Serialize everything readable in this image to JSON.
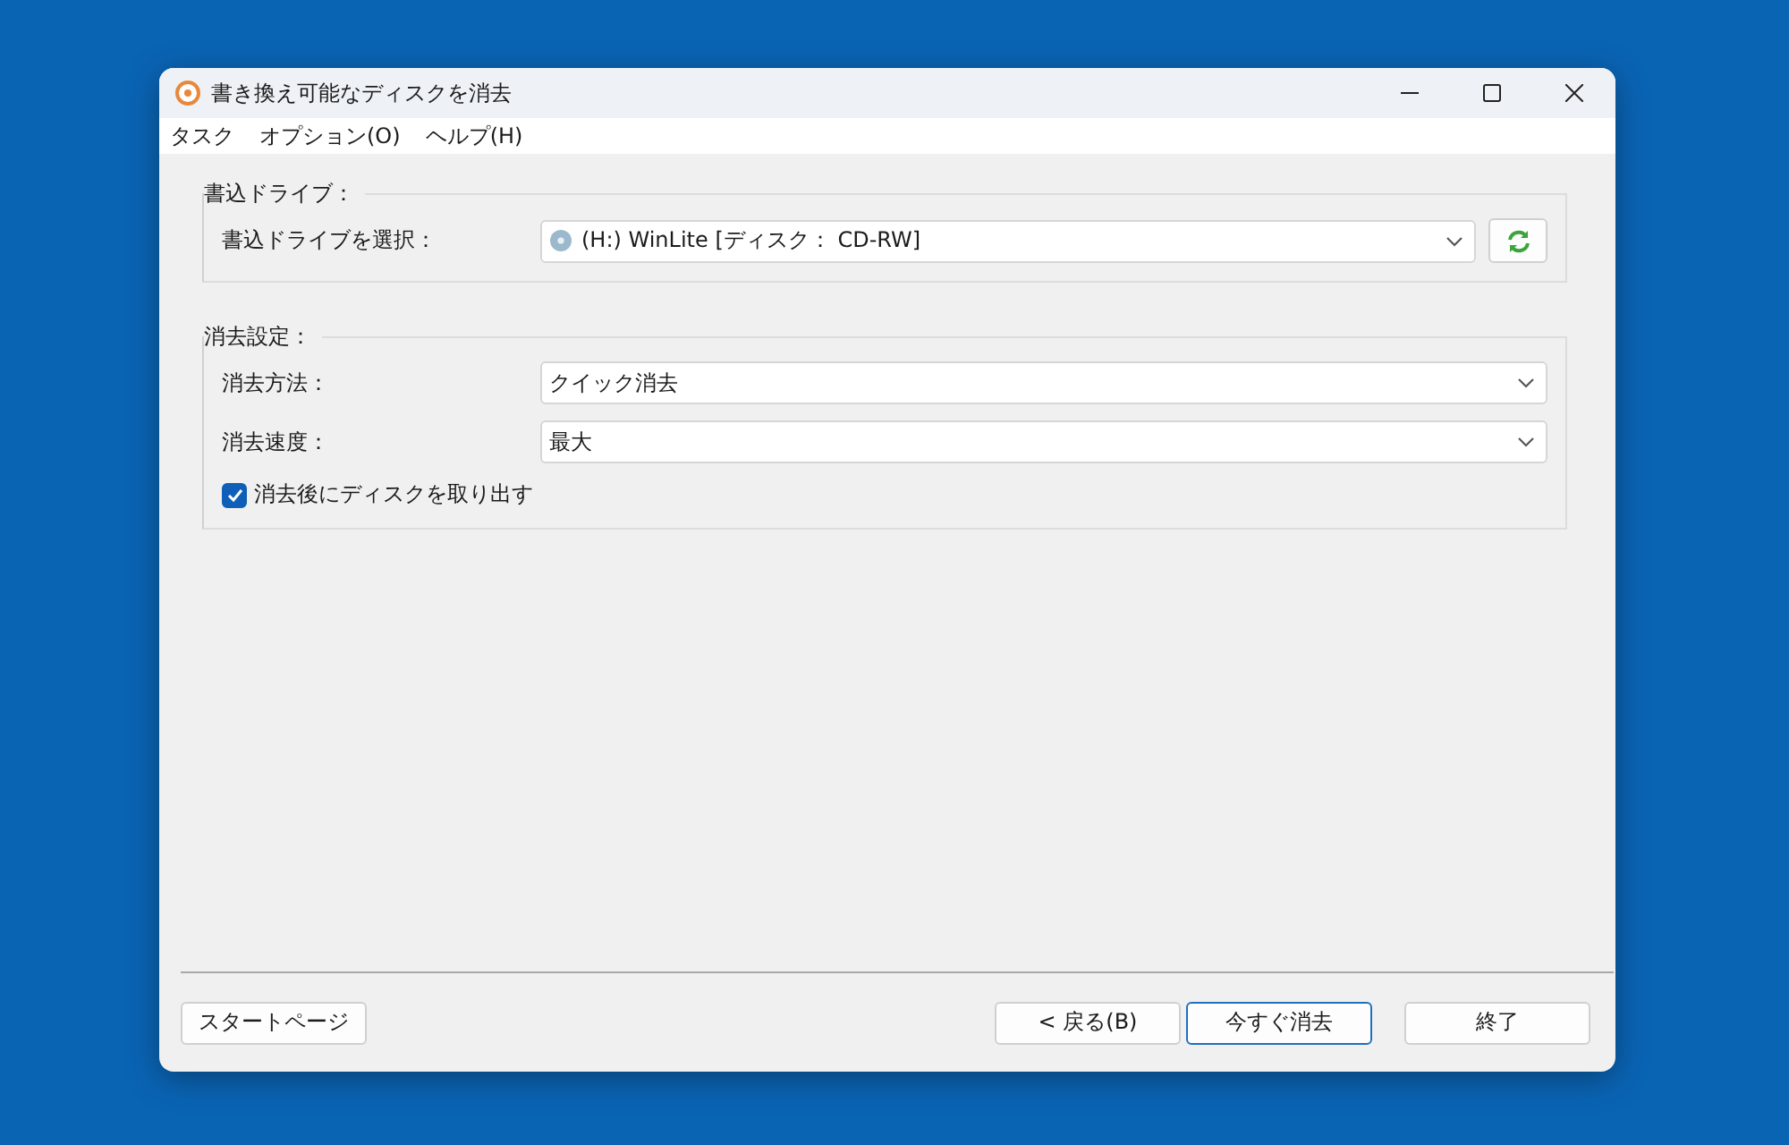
{
  "window": {
    "title": "書き換え可能なディスクを消去"
  },
  "menu": [
    {
      "label": "タスク"
    },
    {
      "label": "オプション(O)"
    },
    {
      "label": "ヘルプ(H)"
    }
  ],
  "drive_group": {
    "title": "書込ドライブ：",
    "label": "書込ドライブを選択：",
    "value": "(H:) WinLite [ディスク： CD-RW]"
  },
  "erase_group": {
    "title": "消去設定：",
    "rows": [
      {
        "label": "消去方法：",
        "value": "クイック消去"
      },
      {
        "label": "消去速度：",
        "value": "最大"
      }
    ],
    "eject": {
      "label": "消去後にディスクを取り出す",
      "checked": true
    }
  },
  "buttons": [
    {
      "label": "スタートページ",
      "kind": "left",
      "default": false
    },
    {
      "label": "< 戻る(B)",
      "kind": "right",
      "default": false
    },
    {
      "label": "今すぐ消去",
      "kind": "right",
      "default": true
    },
    {
      "label": "終了",
      "kind": "right",
      "default": false
    }
  ]
}
